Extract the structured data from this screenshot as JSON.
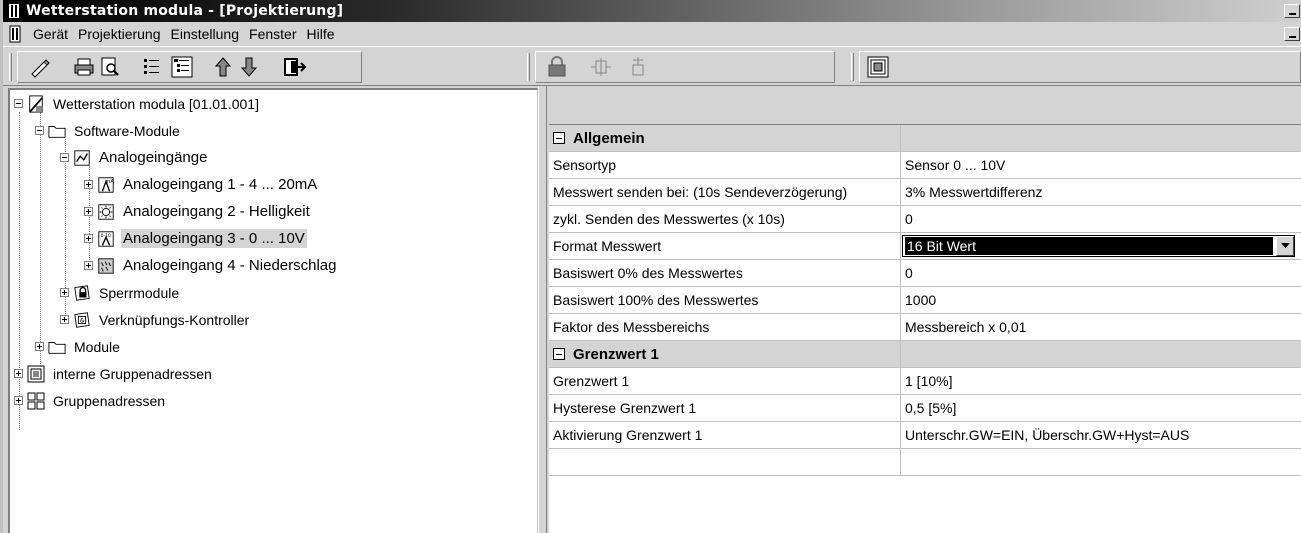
{
  "window": {
    "title": "Wetterstation modula - [Projektierung]"
  },
  "menu": {
    "items": [
      "Gerät",
      "Projektierung",
      "Einstellung",
      "Fenster",
      "Hilfe"
    ]
  },
  "toolbar": {
    "buttons": [
      "edit-icon",
      "print-icon",
      "print-preview-icon",
      "list-icon",
      "tree-view-icon",
      "arrow-up-icon",
      "arrow-down-icon",
      "exit-icon",
      "lock-icon",
      "connector-icon",
      "branch-icon",
      "group-address-icon"
    ]
  },
  "tree": {
    "root": "Wetterstation modula [01.01.001]",
    "software_modules": "Software-Module",
    "analog_inputs": "Analogeingänge",
    "ai1": "Analogeingang 1 - 4 ... 20mA",
    "ai2": "Analogeingang 2 - Helligkeit",
    "ai3": "Analogeingang 3 - 0 ... 10V",
    "ai4": "Analogeingang 4 - Niederschlag",
    "lock_modules": "Sperrmodule",
    "logic_controller": "Verknüpfungs-Kontroller",
    "modules": "Module",
    "internal_groups": "interne Gruppenadressen",
    "groups": "Gruppenadressen"
  },
  "properties": {
    "cat_general": "Allgemein",
    "rows_general": [
      {
        "key": "Sensortyp",
        "value": "Sensor 0 ... 10V"
      },
      {
        "key": "Messwert senden bei: (10s Sendeverzögerung)",
        "value": "3% Messwertdifferenz"
      },
      {
        "key": "zykl. Senden des Messwertes (x 10s)",
        "value": "0"
      },
      {
        "key": "Format Messwert",
        "value": "16 Bit Wert"
      },
      {
        "key": "Basiswert 0% des Messwertes",
        "value": "0"
      },
      {
        "key": "Basiswert 100% des Messwertes",
        "value": "1000"
      },
      {
        "key": "Faktor des Messbereichs",
        "value": "Messbereich x 0,01"
      }
    ],
    "cat_limit": "Grenzwert 1",
    "rows_limit": [
      {
        "key": "Grenzwert 1",
        "value": "1 [10%]"
      },
      {
        "key": "Hysterese Grenzwert 1",
        "value": "0,5 [5%]"
      },
      {
        "key": "Aktivierung Grenzwert 1",
        "value": "Unterschr.GW=EIN, Überschr.GW+Hyst=AUS"
      }
    ]
  }
}
